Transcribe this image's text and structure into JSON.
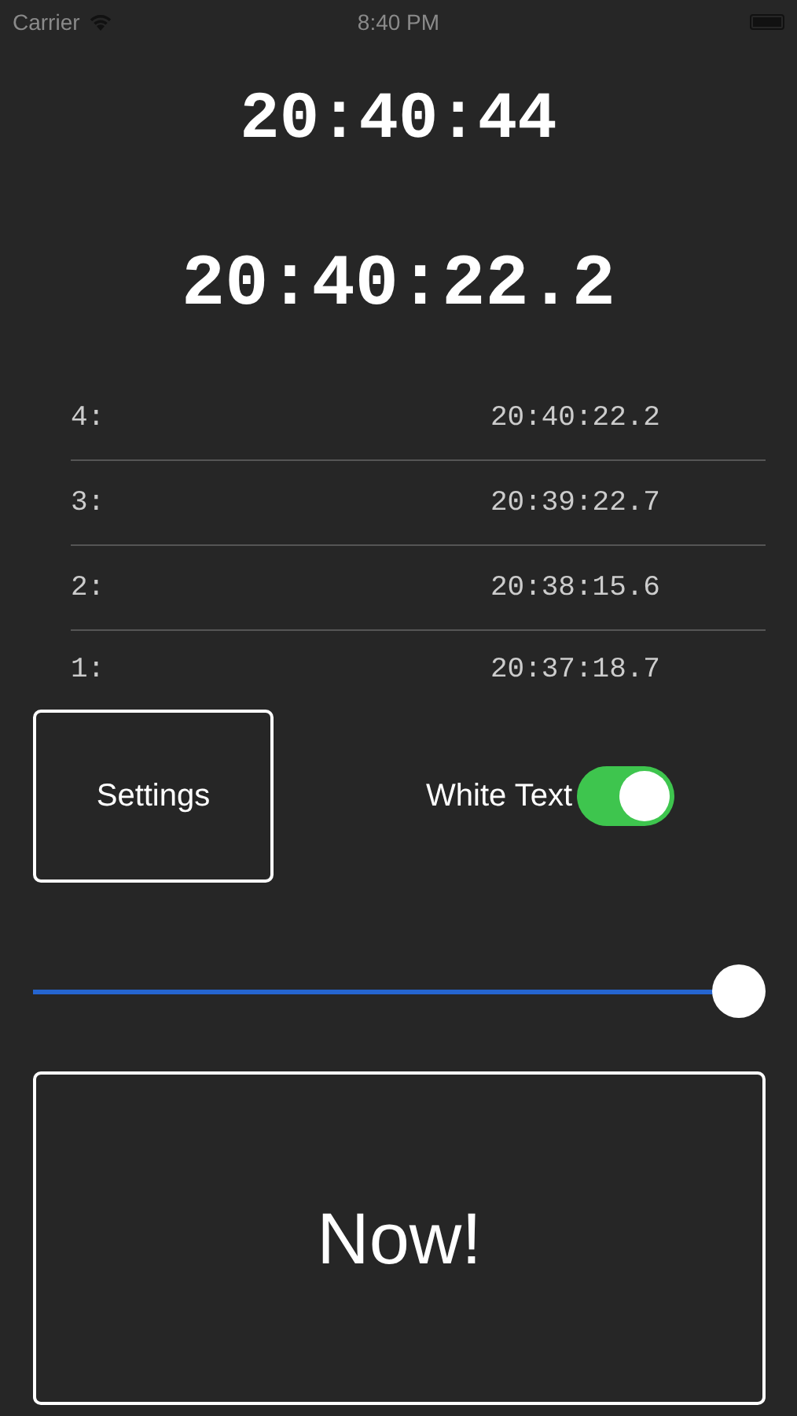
{
  "status_bar": {
    "carrier": "Carrier",
    "time": "8:40 PM"
  },
  "current_time": "20:40:44",
  "last_mark": "20:40:22.2",
  "laps": [
    {
      "label": "4:",
      "time": "20:40:22.2"
    },
    {
      "label": "3:",
      "time": "20:39:22.7"
    },
    {
      "label": "2:",
      "time": "20:38:15.6"
    },
    {
      "label": "1:",
      "time": "20:37:18.7"
    }
  ],
  "settings_button": "Settings",
  "white_text": {
    "label": "White Text",
    "on": true
  },
  "slider": {
    "level": 1.0
  },
  "now_button": "Now!"
}
